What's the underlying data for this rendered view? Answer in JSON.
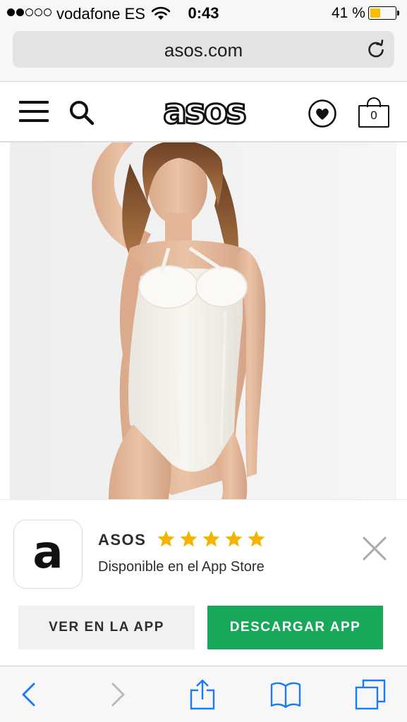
{
  "status_bar": {
    "carrier": "vodafone ES",
    "signal_bars": 2,
    "signal_total": 5,
    "time": "0:43",
    "battery_text": "41 %",
    "battery_level": 0.41,
    "battery_color": "#f5c000"
  },
  "browser": {
    "url": "asos.com"
  },
  "site_header": {
    "logo": "asos",
    "bag_count": "0"
  },
  "app_banner": {
    "icon_letter": "a",
    "app_name": "ASOS",
    "rating": 5,
    "star_color": "#f5b400",
    "subtitle": "Disponible en el App Store",
    "open_button": "VER EN LA APP",
    "get_button": "DESCARGAR APP",
    "get_button_color": "#17a85a"
  },
  "icons": {
    "menu": "hamburger-menu-icon",
    "search": "search-icon",
    "saved": "heart-circle-icon",
    "bag": "shopping-bag-icon",
    "close": "close-icon",
    "reload": "reload-icon",
    "back": "back-chevron-icon",
    "forward": "forward-chevron-icon",
    "share": "share-icon",
    "bookmarks": "bookmarks-icon",
    "tabs": "tabs-icon"
  }
}
